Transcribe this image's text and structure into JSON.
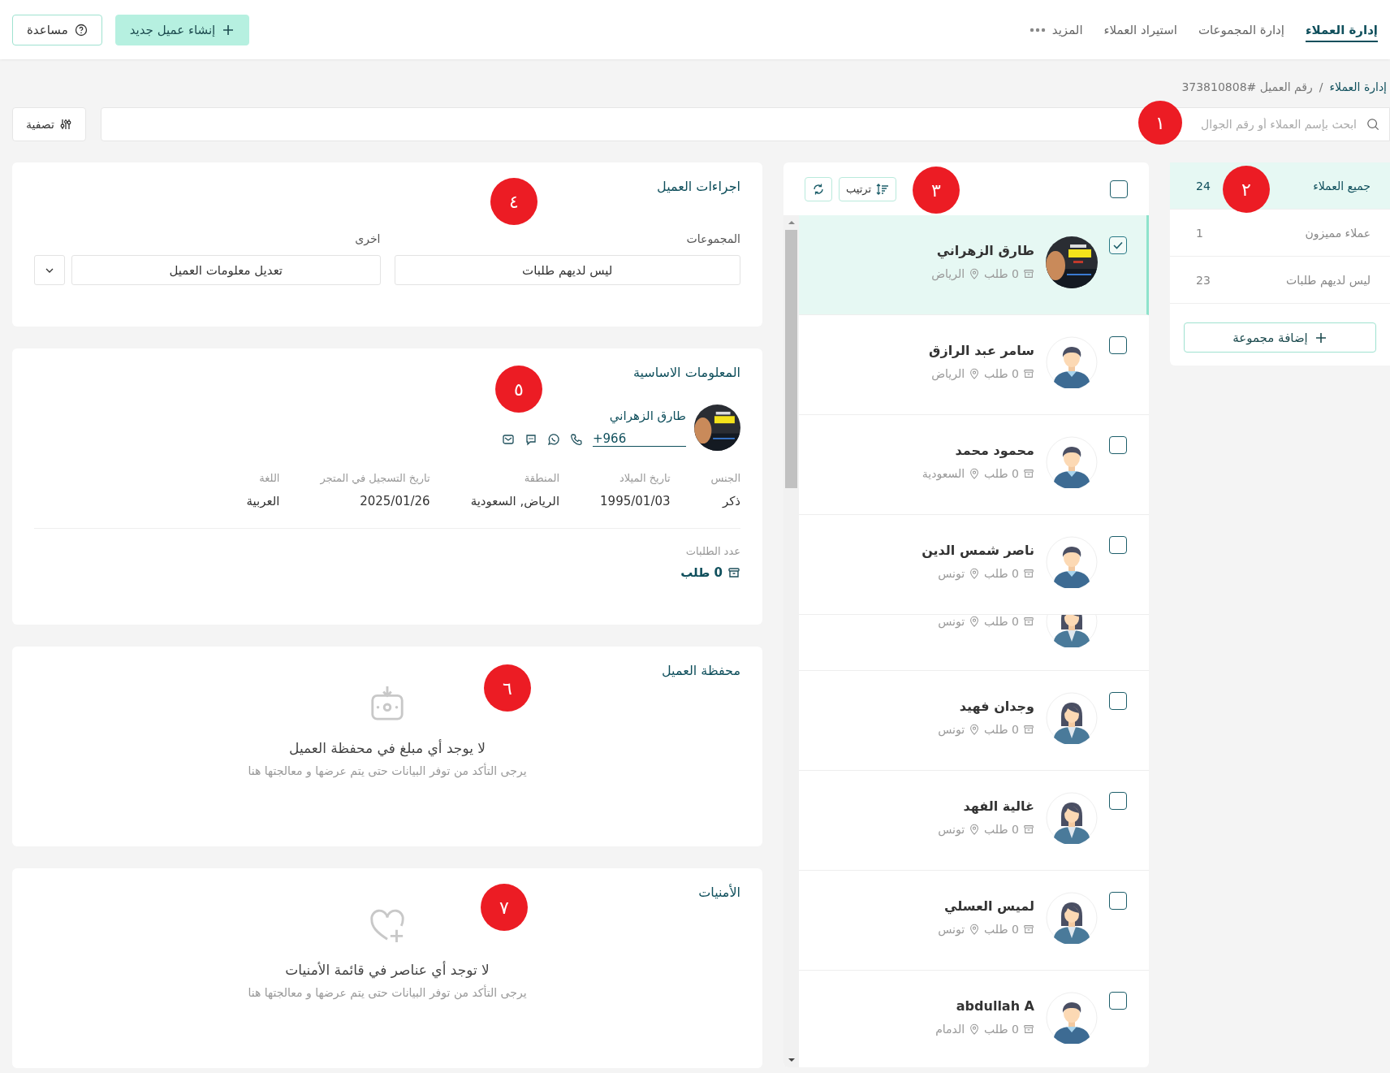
{
  "top_nav": {
    "tabs": [
      {
        "label": "إدارة العملاء",
        "selected": true,
        "kind": "plain"
      },
      {
        "label": "إدارة المجموعات",
        "selected": false,
        "kind": "plain"
      },
      {
        "label": "استيراد العملاء",
        "selected": false,
        "kind": "plain"
      },
      {
        "label": "المزيد",
        "selected": false,
        "kind": "more"
      }
    ],
    "buttons": [
      {
        "label": "إنشاء عميل جديد",
        "kind": "primary"
      },
      {
        "label": "مساعدة",
        "kind": "help"
      }
    ]
  },
  "breadcrumb": [
    {
      "label": "إدارة العملاء",
      "kind": "link"
    },
    {
      "label": "/",
      "kind": "separator"
    },
    {
      "label": "رقم العميل #373810808",
      "kind": "current"
    }
  ],
  "search": {
    "placeholder": "ابحث بإسم العملاء أو رقم الجوال",
    "marker": "١"
  },
  "filter_button": "تصفية",
  "groups": {
    "marker": "٢",
    "items": [
      {
        "label": "جميع العملاء",
        "count": "24",
        "selected": true
      },
      {
        "label": "عملاء مميزون",
        "count": "1",
        "selected": false
      },
      {
        "label": "ليس لديهم طلبات",
        "count": "23",
        "selected": false
      }
    ],
    "add_button": "إضافة مجموعة"
  },
  "customer_list": {
    "marker": "٣",
    "select_all_checked": false,
    "sort_button": "ترتيب",
    "customers": [
      {
        "kind": "full",
        "name": "طارق الزهراني",
        "orders": "0 طلب",
        "city": "الرياض",
        "checked": true,
        "selected": true
      },
      {
        "kind": "full",
        "name": "سامر عبد الرازق",
        "orders": "0 طلب",
        "city": "الرياض",
        "avatar": {
          "kind": "male"
        },
        "checked": false,
        "selected": false
      },
      {
        "kind": "full",
        "name": "محمود محمد",
        "orders": "0 طلب",
        "city": "السعودية",
        "avatar": {
          "kind": "male"
        },
        "checked": false,
        "selected": false
      },
      {
        "kind": "full",
        "name": "ناصر شمس الدين",
        "orders": "0 طلب",
        "city": "تونس",
        "avatar": {
          "kind": "male"
        },
        "checked": false,
        "selected": false
      },
      {
        "kind": "partial",
        "orders": "0 طلب",
        "city": "تونس",
        "avatar": {
          "kind": "female"
        },
        "selected": false
      },
      {
        "kind": "full",
        "name": "وجدان فهيد",
        "orders": "0 طلب",
        "city": "تونس",
        "avatar": {
          "kind": "female"
        },
        "checked": false,
        "selected": false
      },
      {
        "kind": "full",
        "name": "غالية الفهد",
        "orders": "0 طلب",
        "city": "تونس",
        "avatar": {
          "kind": "female"
        },
        "checked": false,
        "selected": false
      },
      {
        "kind": "full",
        "name": "لميس العسلي",
        "orders": "0 طلب",
        "city": "تونس",
        "avatar": {
          "kind": "female"
        },
        "checked": false,
        "selected": false
      },
      {
        "kind": "full",
        "name": "abdullah A",
        "orders": "0 طلب",
        "city": "الدمام",
        "avatar": {
          "kind": "male"
        },
        "checked": false,
        "selected": false
      }
    ]
  },
  "actions": {
    "title": "اجراءات العميل",
    "marker": "٤",
    "fields": [
      {
        "label": "المجموعات",
        "value": "ليس لديهم طلبات",
        "kind": "select"
      },
      {
        "label": "اخرى",
        "value": "تعديل معلومات العميل",
        "kind": "dropdown"
      }
    ]
  },
  "basic_info": {
    "title": "المعلومات الاساسية",
    "marker": "٥",
    "name": "طارق الزهراني",
    "phone": "+966",
    "details": [
      {
        "label": "الجنس",
        "value": "ذكر"
      },
      {
        "label": "تاريخ الميلاد",
        "value": "1995/01/03"
      },
      {
        "label": "المنطقة",
        "value": "الرياض, السعودية"
      },
      {
        "label": "تاريخ التسجيل في المتجر",
        "value": "2025/01/26"
      },
      {
        "label": "اللغة",
        "value": "العربية"
      }
    ],
    "orders_label": "عدد الطلبات",
    "orders_value": "0 طلب"
  },
  "wallet": {
    "title": "محفظة العميل",
    "marker": "٦",
    "empty_title": "لا يوجد أي مبلغ في محفظة العميل",
    "empty_text": "يرجى التأكد من توفر البيانات حتى يتم عرضها و معالجتها هنا"
  },
  "wishlist": {
    "title": "الأمنيات",
    "marker": "٧",
    "empty_title": "لا توجد أي عناصر في قائمة الأمنيات",
    "empty_text": "يرجى التأكد من توفر البيانات حتى يتم عرضها و معالجتها هنا"
  }
}
